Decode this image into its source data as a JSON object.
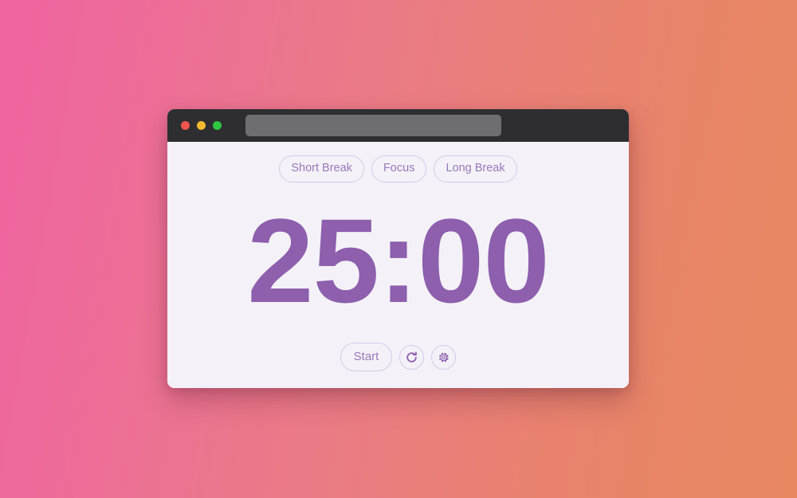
{
  "background": {
    "gradient_from": "#ef639e",
    "gradient_to": "#e78760",
    "direction": "left-to-right"
  },
  "window": {
    "titlebar": {
      "background": "#2e2e31",
      "traffic_lights": [
        {
          "name": "close",
          "color": "#f2564e"
        },
        {
          "name": "minimize",
          "color": "#f3bb2d"
        },
        {
          "name": "maximize",
          "color": "#2fc741"
        }
      ],
      "address_bar": {
        "value": "",
        "placeholder": "",
        "background": "#6e6e70"
      }
    },
    "app": {
      "background": "#f4f2f8",
      "accent": "#8d5fad",
      "muted_accent": "#9a78ba",
      "border_color": "#d9c8ea",
      "modes": [
        {
          "id": "short-break",
          "label": "Short Break",
          "selected": false
        },
        {
          "id": "focus",
          "label": "Focus",
          "selected": false
        },
        {
          "id": "long-break",
          "label": "Long Break",
          "selected": false
        }
      ],
      "timer": {
        "display": "25:00",
        "minutes": "25",
        "seconds": "00"
      },
      "controls": {
        "start_label": "Start",
        "reset_icon": "reset-refresh-icon",
        "settings_icon": "gear-icon"
      }
    }
  }
}
